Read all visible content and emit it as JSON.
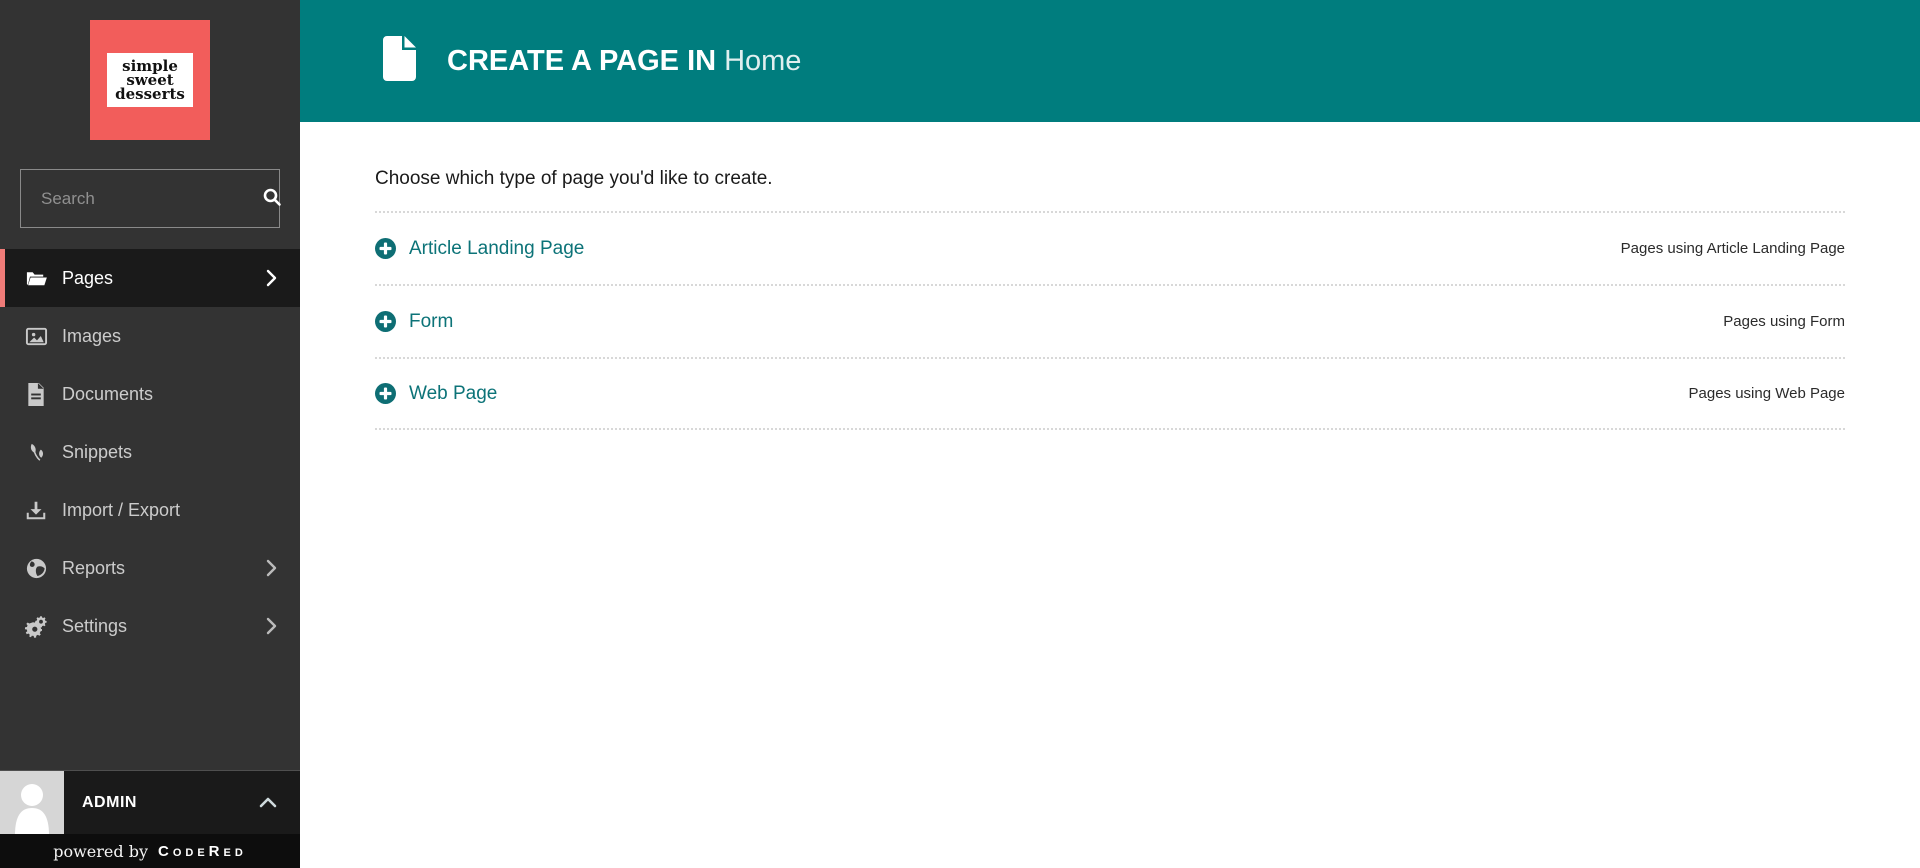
{
  "sidebar": {
    "logo": {
      "line1": "simple",
      "line2": "sweet",
      "line3": "desserts"
    },
    "search": {
      "placeholder": "Search",
      "value": ""
    },
    "items": [
      {
        "label": "Pages",
        "icon": "folder-open-icon",
        "active": true,
        "chevron": true
      },
      {
        "label": "Images",
        "icon": "image-icon",
        "active": false,
        "chevron": false
      },
      {
        "label": "Documents",
        "icon": "document-icon",
        "active": false,
        "chevron": false
      },
      {
        "label": "Snippets",
        "icon": "snippets-icon",
        "active": false,
        "chevron": false
      },
      {
        "label": "Import / Export",
        "icon": "download-icon",
        "active": false,
        "chevron": false
      },
      {
        "label": "Reports",
        "icon": "globe-icon",
        "active": false,
        "chevron": true
      },
      {
        "label": "Settings",
        "icon": "gears-icon",
        "active": false,
        "chevron": true
      }
    ],
    "admin": {
      "label": "ADMIN"
    },
    "powered": {
      "prefix": "powered by",
      "brand": "CodeRed"
    }
  },
  "header": {
    "title_strong": "CREATE A PAGE IN",
    "title_light": "Home"
  },
  "main": {
    "intro": "Choose which type of page you'd like to create.",
    "page_types": [
      {
        "label": "Article Landing Page",
        "usage": "Pages using Article Landing Page"
      },
      {
        "label": "Form",
        "usage": "Pages using Form"
      },
      {
        "label": "Web Page",
        "usage": "Pages using Web Page"
      }
    ]
  },
  "colors": {
    "header_teal": "#007d7e",
    "link_teal": "#0c7378",
    "logo_red": "#f25d5b",
    "active_accent_salmon": "#ef7b78",
    "sidebar_bg": "#333333",
    "active_bg": "#1a1a1a"
  }
}
